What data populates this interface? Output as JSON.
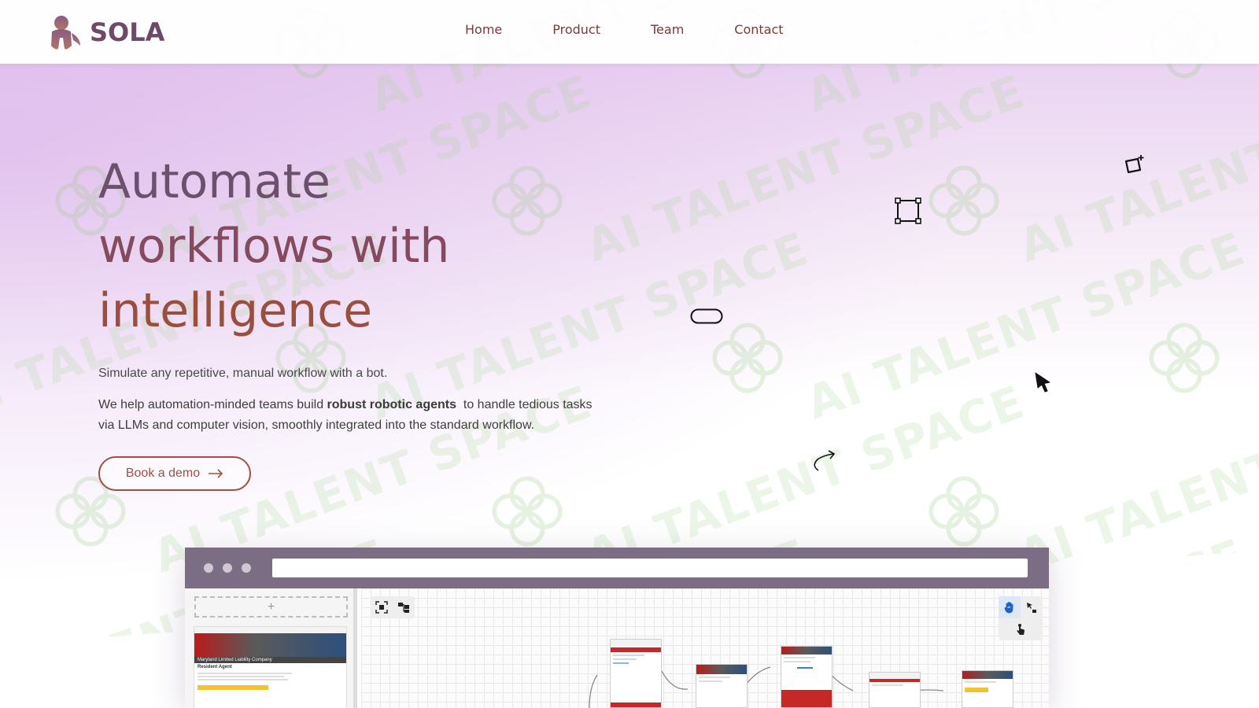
{
  "brand": {
    "name": "SOLA",
    "color": "#6e4a66"
  },
  "nav": {
    "items": [
      "Home",
      "Product",
      "Team",
      "Contact"
    ]
  },
  "hero": {
    "title_lines": [
      "Automate",
      "workflows with",
      "intelligence"
    ],
    "subtitle": "Simulate any repetitive, manual workflow with a bot.",
    "desc_before": "We help automation-minded teams build ",
    "desc_bold": "robust robotic agents",
    "desc_after": "  to handle tedious tasks via LLMs and computer vision, smoothly integrated into the standard workflow.",
    "cta_label": "Book a demo"
  },
  "watermark": {
    "text": "AI TALENT SPACE"
  },
  "mockup": {
    "add_label": "+",
    "thumb_caption": "Maryland Limited Liability Company",
    "thumb_heading": "Resident Agent"
  },
  "icons": {
    "floating": [
      "sparkle-frame-icon",
      "square-select-icon",
      "pill-icon",
      "pointer-icon",
      "redo-arrow-icon"
    ],
    "toolbar": [
      "fit-view-icon",
      "layout-icon",
      "hand-icon",
      "drag-icon",
      "touch-icon"
    ]
  },
  "colors": {
    "accent": "#a24e46",
    "title_top": "#6d4f6e",
    "title_mid": "#844a5d",
    "title_bottom": "#9a4f3e",
    "mock_bar": "#7b6d84"
  }
}
